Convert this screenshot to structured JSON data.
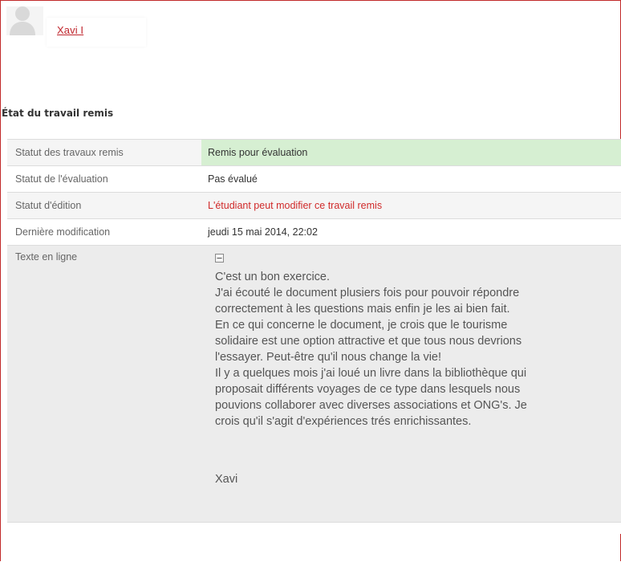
{
  "user": {
    "name": "Xavi I"
  },
  "section": {
    "heading": "État du travail remis"
  },
  "status_rows": [
    {
      "label": "Statut des travaux remis",
      "value": "Remis pour évaluation"
    },
    {
      "label": "Statut de l'évaluation",
      "value": "Pas évalué"
    },
    {
      "label": "Statut d'édition",
      "value": "L'étudiant peut modifier ce travail remis"
    },
    {
      "label": "Dernière modification",
      "value": "jeudi 15 mai 2014, 22:02"
    }
  ],
  "online_text": {
    "label": "Texte en ligne",
    "lines": [
      "C'est un bon exercice.",
      "J'ai écouté le document plusiers fois pour pouvoir répondre",
      "correctement à les questions mais enfin je les ai bien fait.",
      "En ce qui concerne le document, je crois que le tourisme",
      "solidaire est une option attractive et que tous nous devrions",
      "l'essayer. Peut-être qu'il nous change la vie!",
      "Il y a quelques mois j'ai loué un livre dans la bibliothèque qui",
      "proposait différents voyages de ce type dans lesquels nous",
      "pouvions collaborer avec  diverses associations et ONG's. Je",
      "crois qu'il s'agit d'expériences trés enrichissantes."
    ],
    "signature": "Xavi"
  },
  "colors": {
    "frame_border": "#c12a2a",
    "submitted_bg": "#d6efd2",
    "edit_status_text": "#d02a2a",
    "link": "#c0262d"
  },
  "icons": {
    "avatar": "user-avatar-placeholder",
    "collapse": "collapse-box-icon"
  }
}
